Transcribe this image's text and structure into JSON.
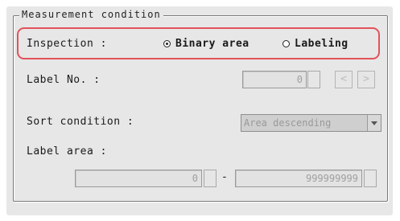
{
  "group": {
    "title": "Measurement condition"
  },
  "inspection": {
    "label": "Inspection :",
    "options": [
      {
        "label": "Binary area",
        "checked": true
      },
      {
        "label": "Labeling",
        "checked": false
      }
    ]
  },
  "label_no": {
    "label": "Label No. :",
    "value": "0",
    "prev_icon": "<",
    "next_icon": ">"
  },
  "sort_condition": {
    "label": "Sort condition :",
    "value": "Area descending"
  },
  "label_area": {
    "label": "Label area :",
    "min_value": "0",
    "separator": "-",
    "max_value": "999999999"
  },
  "colors": {
    "highlight": "#e3525a",
    "panel_bg": "#e7e7e7",
    "disabled_text": "#a0a0a0"
  }
}
